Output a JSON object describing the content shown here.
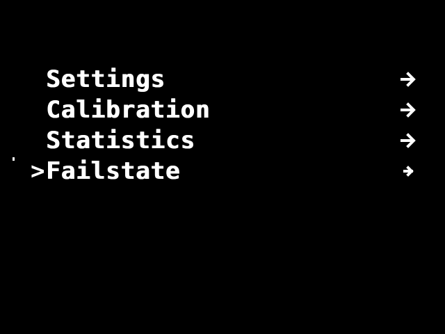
{
  "menu": {
    "cursor_glyph": ">",
    "selected_index": 3,
    "items": [
      {
        "label": "Settings",
        "arrow_icon": "arrow-right-icon"
      },
      {
        "label": "Calibration",
        "arrow_icon": "arrow-right-icon"
      },
      {
        "label": "Statistics",
        "arrow_icon": "arrow-right-icon"
      },
      {
        "label": "Failstate",
        "arrow_icon": "arrow-right-icon"
      }
    ]
  },
  "colors": {
    "background": "#000000",
    "foreground": "#ffffff"
  }
}
